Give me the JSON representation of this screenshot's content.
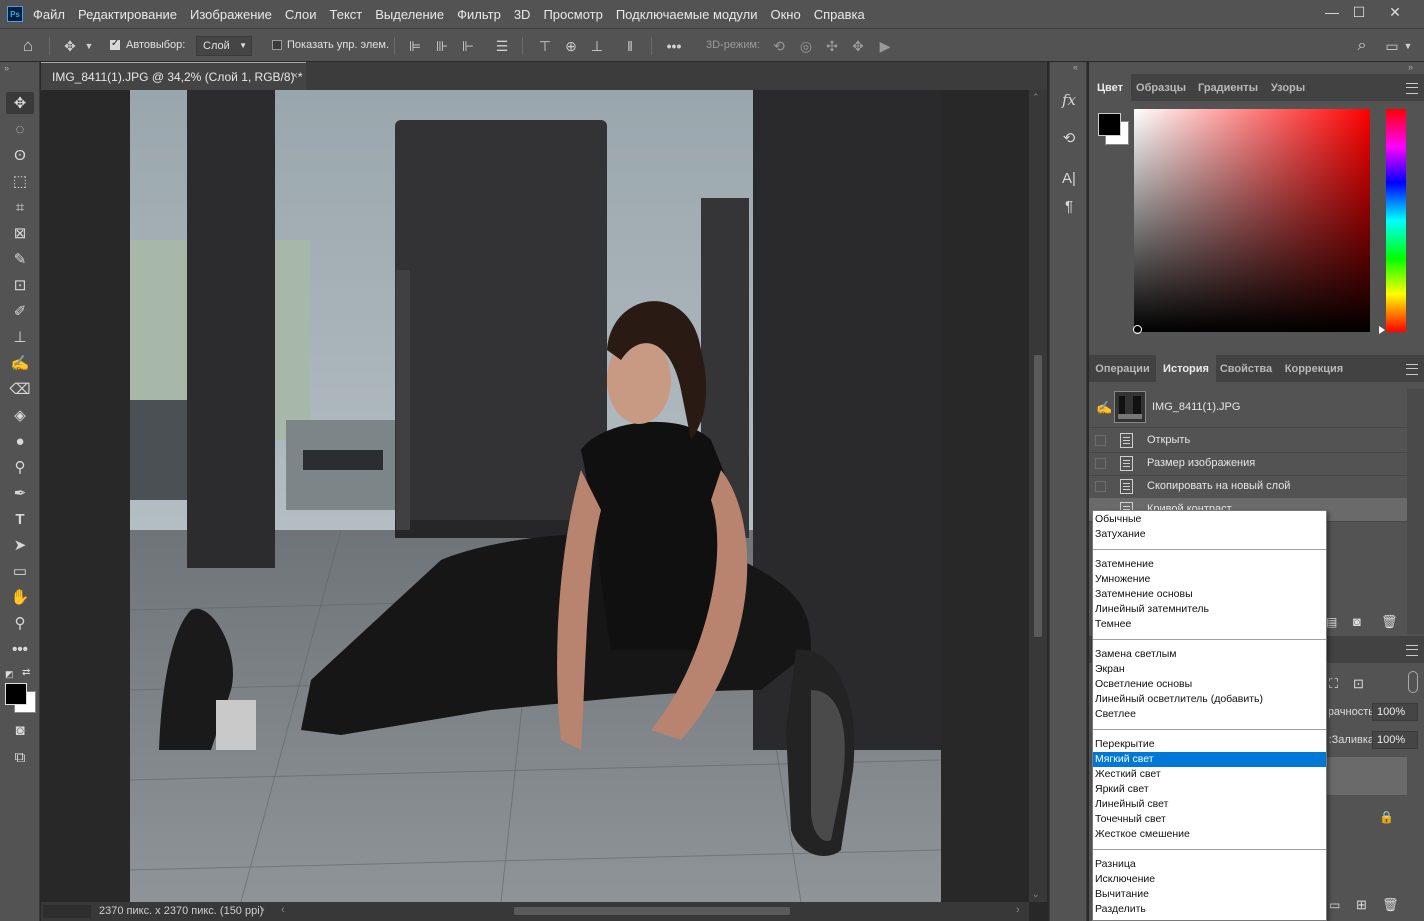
{
  "menu": {
    "items": [
      "Файл",
      "Редактирование",
      "Изображение",
      "Слои",
      "Текст",
      "Выделение",
      "Фильтр",
      "3D",
      "Просмотр",
      "Подключаемые модули",
      "Окно",
      "Справка"
    ],
    "window_controls": [
      "—",
      "☐",
      "✕"
    ]
  },
  "options_bar": {
    "auto_select_label": "Автовыбор:",
    "auto_select_value": "Слой",
    "show_transform_label": "Показать упр. элем.",
    "mode_3d_label": "3D-режим:",
    "more_label": "•••"
  },
  "document": {
    "tab_title": "IMG_8411(1).JPG @ 34,2% (Слой 1, RGB/8) *",
    "status": "2370 пикс. x 2370 пикс. (150 ppi)"
  },
  "color_panel": {
    "tabs": [
      "Цвет",
      "Образцы",
      "Градиенты",
      "Узоры"
    ],
    "active_tab": "Цвет",
    "foreground": "#000000",
    "background": "#ffffff"
  },
  "history_panel": {
    "tabs": [
      "Операции",
      "История",
      "Свойства",
      "Коррекция"
    ],
    "active_tab": "История",
    "snapshot": "IMG_8411(1).JPG",
    "items": [
      "Открыть",
      "Размер изображения",
      "Скопировать на новый слой",
      "Кривой контраст"
    ]
  },
  "layers_panel": {
    "opacity_label": "Непрозрачность:",
    "opacity_value": "100%",
    "fill_label": "Заливка:",
    "fill_value": "100%"
  },
  "blend_modes": {
    "selected": "Мягкий свет",
    "groups": [
      [
        "Обычные",
        "Затухание"
      ],
      [
        "Затемнение",
        "Умножение",
        "Затемнение основы",
        "Линейный затемнитель",
        "Темнее"
      ],
      [
        "Замена светлым",
        "Экран",
        "Осветление основы",
        "Линейный осветлитель (добавить)",
        "Светлее"
      ],
      [
        "Перекрытие",
        "Мягкий свет",
        "Жесткий свет",
        "Яркий свет",
        "Линейный свет",
        "Точечный свет",
        "Жесткое смешение"
      ],
      [
        "Разница",
        "Исключение",
        "Вычитание",
        "Разделить"
      ]
    ]
  }
}
